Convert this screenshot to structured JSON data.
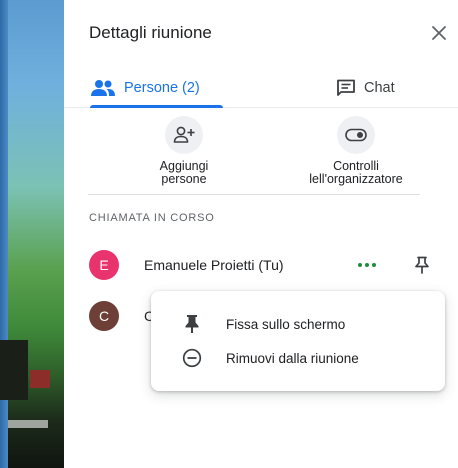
{
  "panel": {
    "title": "Dettagli riunione"
  },
  "tabs": [
    {
      "label": "Persone (2)",
      "active": true,
      "icon": "people-icon"
    },
    {
      "label": "Chat",
      "active": false,
      "icon": "chat-icon"
    }
  ],
  "actions": {
    "add_people": "Aggiungi\npersone",
    "host_controls": "Controlli\nlell'organizzatore"
  },
  "section_title": "CHIAMATA IN CORSO",
  "participants": [
    {
      "initial": "E",
      "name": "Emanuele Proietti (Tu)",
      "avatar_color": "#e8336e"
    },
    {
      "initial": "C",
      "name": "C",
      "avatar_color": "#6d3f36"
    }
  ],
  "context_menu": {
    "items": [
      {
        "label": "Fissa sullo schermo",
        "icon": "pin-icon"
      },
      {
        "label": "Rimuovi dalla riunione",
        "icon": "remove-circle-icon"
      }
    ]
  },
  "colors": {
    "accent": "#1a73e8",
    "more_dots": "#1e8e3e"
  }
}
